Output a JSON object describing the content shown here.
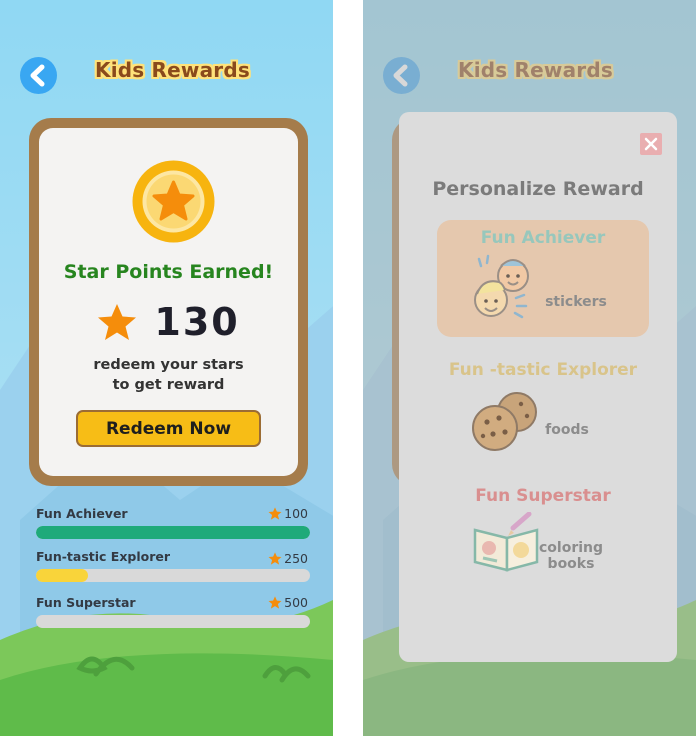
{
  "app": {
    "title": "Kids Rewards"
  },
  "main_screen": {
    "card": {
      "heading": "Star Points Earned!",
      "points": "130",
      "subtitle_line1": "redeem your stars",
      "subtitle_line2": "to get reward",
      "redeem_button": "Redeem Now"
    },
    "progress": [
      {
        "name": "Fun Achiever",
        "target": "100",
        "fraction": 1.0,
        "color": "#1faa7a"
      },
      {
        "name": "Fun-tastic Explorer",
        "target": "250",
        "fraction": 0.19,
        "color": "#f9d43a"
      },
      {
        "name": "Fun Superstar",
        "target": "500",
        "fraction": 0.0,
        "color": "#f9d43a"
      }
    ]
  },
  "modal": {
    "title": "Personalize Reward",
    "options": [
      {
        "title": "Fun Achiever",
        "label": "stickers",
        "icon": "stickers-icon",
        "selected": true,
        "title_color": "#97c7bc"
      },
      {
        "title": "Fun -tastic Explorer",
        "label": "foods",
        "icon": "cookies-icon",
        "selected": false,
        "title_color": "#d9c48a"
      },
      {
        "title": "Fun Superstar",
        "label_line1": "coloring",
        "label_line2": "books",
        "icon": "coloring-book-icon",
        "selected": false,
        "title_color": "#d98f8f"
      }
    ]
  },
  "colors": {
    "accent_blue": "#39a7f2",
    "brand_brown": "#8a4a1c",
    "heading_green": "#27851f",
    "button_yellow": "#f7bd16",
    "star_orange": "#f58d0b"
  }
}
